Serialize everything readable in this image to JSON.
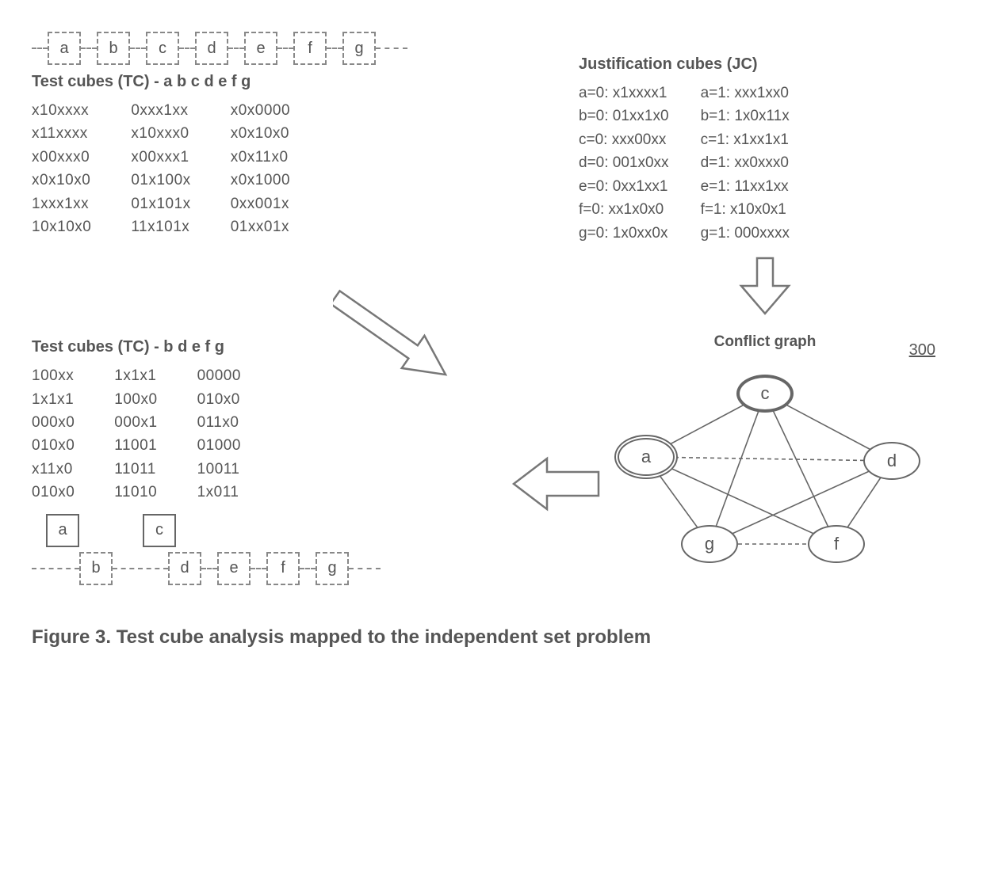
{
  "chain1": [
    "a",
    "b",
    "c",
    "d",
    "e",
    "f",
    "g"
  ],
  "tc1_title": "Test cubes (TC) - a b c d e f g",
  "tc1": {
    "col1": [
      "x10xxxx",
      "x11xxxx",
      "x00xxx0",
      "x0x10x0",
      "1xxx1xx",
      "10x10x0"
    ],
    "col2": [
      "0xxx1xx",
      "x10xxx0",
      "x00xxx1",
      "01x100x",
      "01x101x",
      "11x101x"
    ],
    "col3": [
      "x0x0000",
      "x0x10x0",
      "x0x11x0",
      "x0x1000",
      "0xx001x",
      "01xx01x"
    ]
  },
  "jc_title": "Justification cubes (JC)",
  "jc": {
    "col1": [
      "a=0: x1xxxx1",
      "b=0: 01xx1x0",
      "c=0: xxx00xx",
      "d=0: 001x0xx",
      "e=0: 0xx1xx1",
      "f=0: xx1x0x0",
      "g=0: 1x0xx0x"
    ],
    "col2": [
      "a=1: xxx1xx0",
      "b=1: 1x0x11x",
      "c=1: x1xx1x1",
      "d=1: xx0xxx0",
      "e=1: 11xx1xx",
      "f=1: x10x0x1",
      "g=1: 000xxxx"
    ]
  },
  "tc2_title": "Test cubes (TC) - b d e f g",
  "tc2": {
    "col1": [
      "100xx",
      "1x1x1",
      "000x0",
      "010x0",
      "x11x0",
      "010x0"
    ],
    "col2": [
      "1x1x1",
      "100x0",
      "000x1",
      "11001",
      "11011",
      "11010"
    ],
    "col3": [
      "00000",
      "010x0",
      "011x0",
      "01000",
      "10011",
      "1x011"
    ]
  },
  "chain2_removed": [
    "a",
    "c"
  ],
  "chain2": [
    "b",
    "d",
    "e",
    "f",
    "g"
  ],
  "graph_title": "Conflict graph",
  "graph_ref": "300",
  "graph_nodes": [
    "a",
    "c",
    "d",
    "f",
    "g"
  ],
  "caption": "Figure 3. Test cube analysis mapped to the independent set problem"
}
